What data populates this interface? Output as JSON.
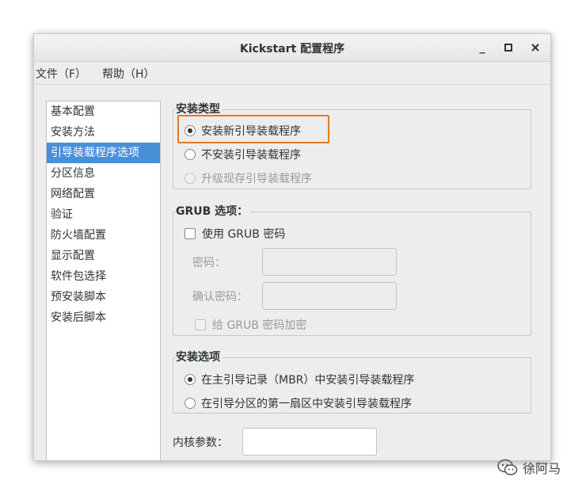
{
  "window": {
    "title": "Kickstart 配置程序",
    "minimize": "_",
    "maximize": "□",
    "close": "✕"
  },
  "menu": {
    "file": "文件（F）",
    "help": "帮助（H）"
  },
  "sidebar": {
    "items": [
      {
        "label": "基本配置"
      },
      {
        "label": "安装方法"
      },
      {
        "label": "引导装载程序选项"
      },
      {
        "label": "分区信息"
      },
      {
        "label": "网络配置"
      },
      {
        "label": "验证"
      },
      {
        "label": "防火墙配置"
      },
      {
        "label": "显示配置"
      },
      {
        "label": "软件包选择"
      },
      {
        "label": "预安装脚本"
      },
      {
        "label": "安装后脚本"
      }
    ],
    "active_index": 2
  },
  "install_type": {
    "legend": "安装类型",
    "options": [
      "安装新引导装载程序",
      "不安装引导装载程序",
      "升级现存引导装载程序"
    ],
    "selected": 0
  },
  "grub": {
    "legend": "GRUB 选项：",
    "use_password": "使用  GRUB 密码",
    "password_label": "密码：",
    "confirm_label": "确认密码：",
    "encrypt": "给  GRUB 密码加密"
  },
  "install_options": {
    "legend": "安装选项",
    "options": [
      "在主引导记录（MBR）中安装引导装载程序",
      "在引导分区的第一扇区中安装引导装载程序"
    ],
    "selected": 0
  },
  "kernel": {
    "label": "内核参数：",
    "value": ""
  },
  "watermark": {
    "text": "徐阿马"
  },
  "colors": {
    "highlight": "#e07b2a",
    "selection": "#4a90d9"
  }
}
